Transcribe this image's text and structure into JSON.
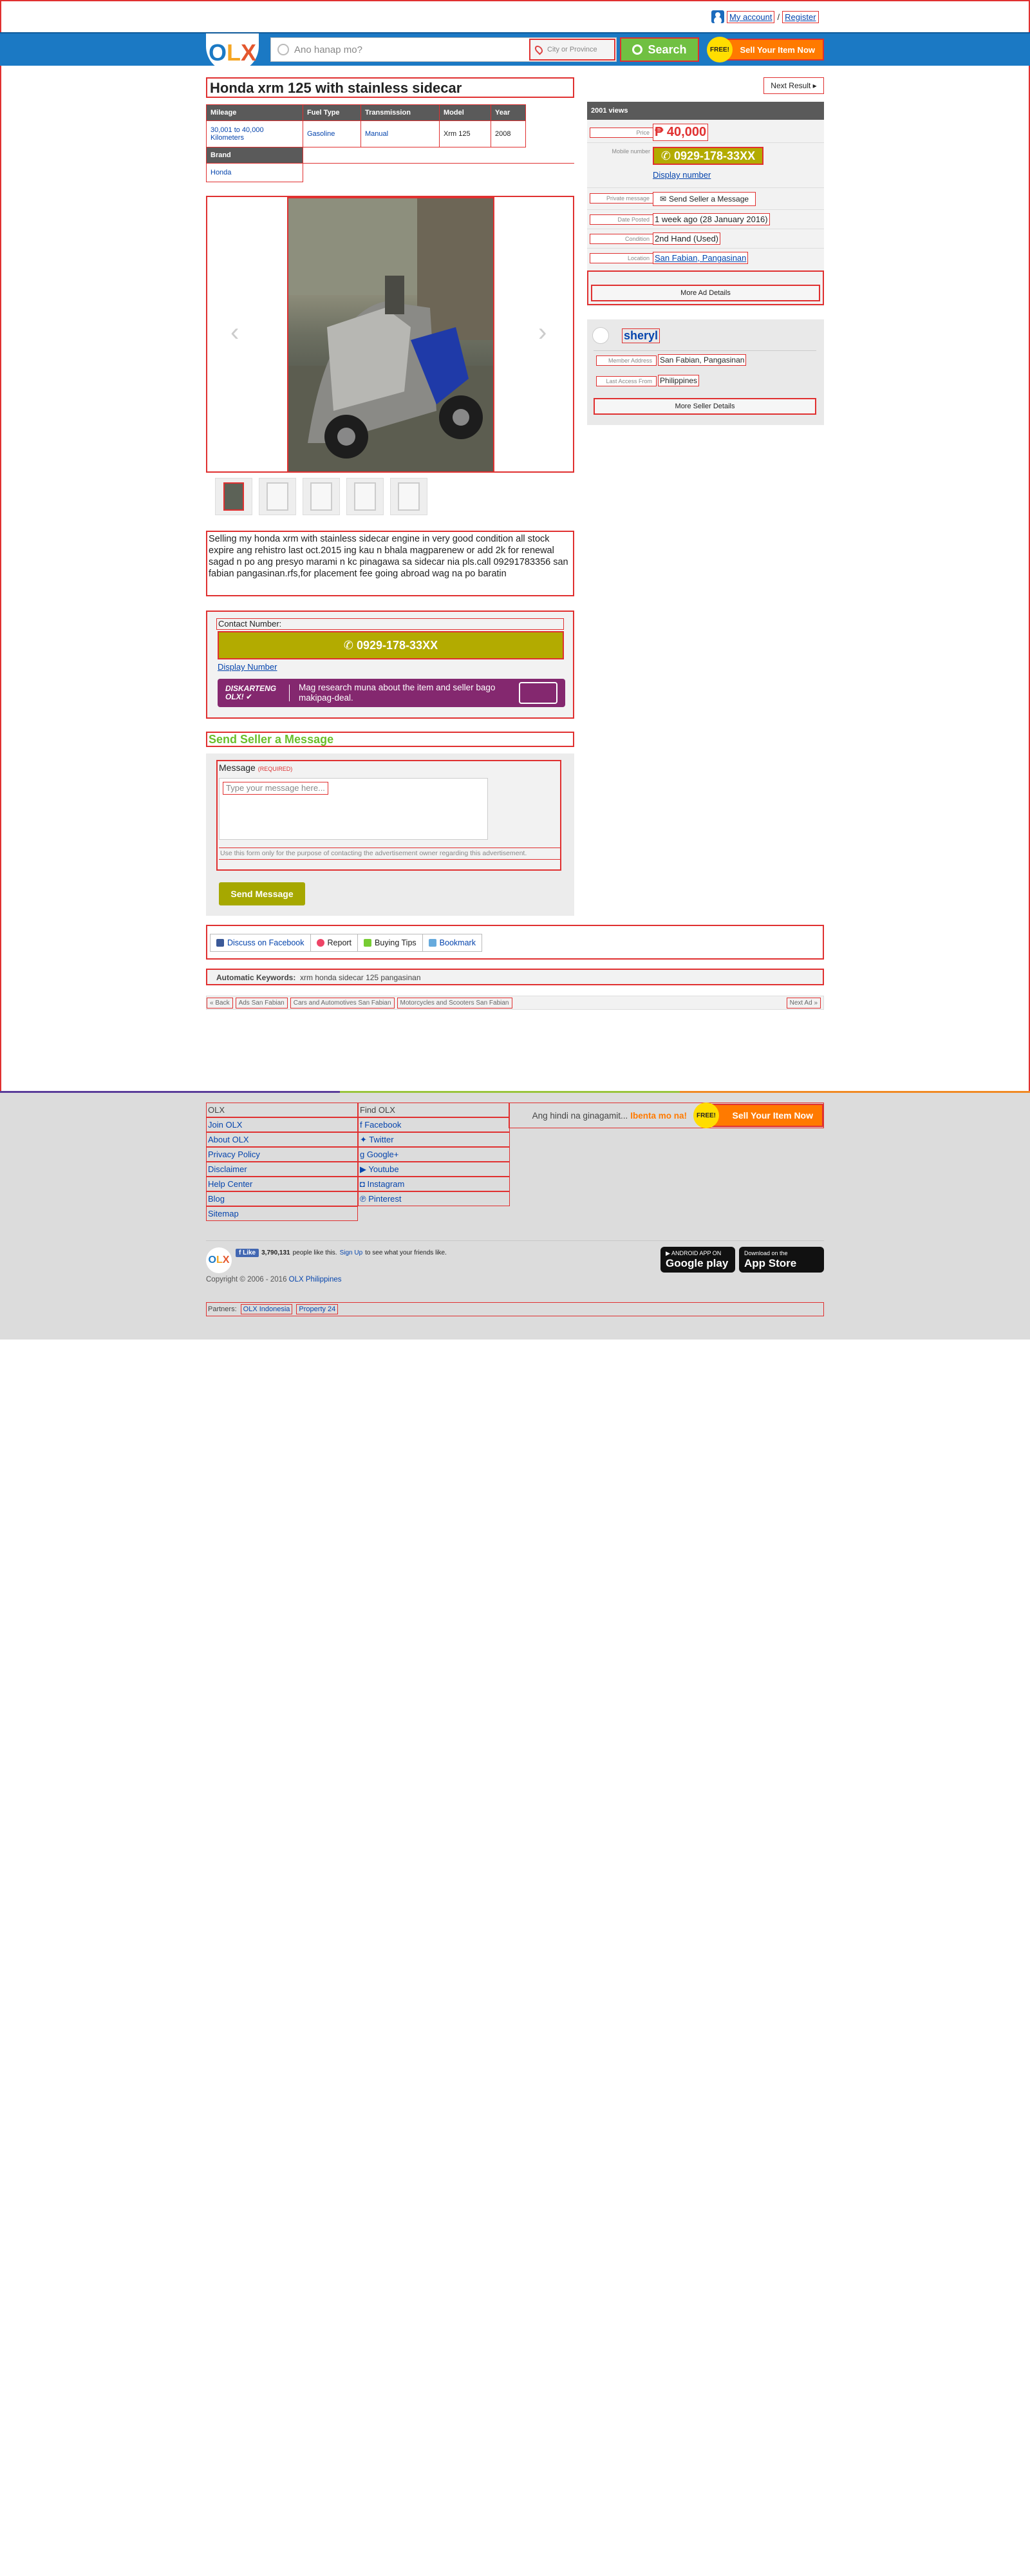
{
  "colors": {
    "brand_blue": "#1b79c4",
    "search_green": "#70c042",
    "sell_orange": "#ff7a00",
    "number_olive": "#b3ab00",
    "promo_purple": "#84286f",
    "price_red": "#e03030"
  },
  "top_bar": {
    "my_account": "My account",
    "separator": "/",
    "register": "Register"
  },
  "header": {
    "logo_o": "O",
    "logo_l": "L",
    "logo_x": "X",
    "search_placeholder": "Ano hanap mo?",
    "city_placeholder": "City or Province",
    "search_button": "Search",
    "free_badge": "FREE!",
    "sell_button": "Sell Your Item Now"
  },
  "ad": {
    "title": "Honda xrm 125 with stainless sidecar",
    "next_result": "Next Result",
    "specs_headers": [
      "Mileage",
      "Fuel Type",
      "Transmission",
      "Model",
      "Year"
    ],
    "specs_values": [
      "30,001 to 40,000 Kilometers",
      "Gasoline",
      "Manual",
      "Xrm 125",
      "2008"
    ],
    "brand_header": "Brand",
    "brand_value": "Honda",
    "description": "Selling my honda xrm with stainless sidecar engine in very good condition all stock expire ang rehistro last oct.2015 ing kau n bhala magparenew or add 2k for renewal sagad n po ang presyo marami n kc pinagawa sa sidecar nia pls.call 09291783356 san fabian pangasinan.rfs,for placement fee going abroad wag na po baratin"
  },
  "contact": {
    "label": "Contact Number:",
    "number": "0929-178-33XX",
    "display_number": "Display Number",
    "promo_brand_line1": "DISKARTENG",
    "promo_brand_line2": "OLX!",
    "promo_text": "Mag research muna about the item and seller bago makipag-deal."
  },
  "message": {
    "section_title": "Send Seller a Message",
    "label": "Message",
    "required": "(REQUIRED)",
    "placeholder": "Type your message here...",
    "note": "Use this form only for the purpose of contacting the advertisement owner regarding this advertisement.",
    "send_button": "Send Message"
  },
  "actions": {
    "facebook": "Discuss on Facebook",
    "report": "Report",
    "tips": "Buying Tips",
    "bookmark": "Bookmark"
  },
  "keywords": {
    "label": "Automatic Keywords:",
    "value": "xrm honda sidecar 125 pangasinan"
  },
  "breadcrumbs": {
    "back": "« Back",
    "items": [
      "Ads San Fabian",
      "Cars and Automotives San Fabian",
      "Motorcycles and Scooters San Fabian"
    ],
    "next": "Next Ad »"
  },
  "sidebar": {
    "views": "2001 views",
    "price_label": "Price",
    "price": "₱ 40,000",
    "mobile_label": "Mobile number",
    "mobile_number": "0929-178-33XX",
    "display_number": "Display number",
    "private_label": "Private message",
    "private_button": "Send Seller a Message",
    "date_label": "Date Posted",
    "date_value": "1 week ago (28 January 2016)",
    "condition_label": "Condition",
    "condition_value": "2nd Hand (Used)",
    "location_label": "Location",
    "location_value": "San Fabian, Pangasinan",
    "more_ad": "More Ad Details"
  },
  "seller": {
    "name": "sheryl",
    "address_label": "Member Address",
    "address_value": "San Fabian, Pangasinan",
    "access_label": "Last Access From",
    "access_value": "Philippines",
    "more_seller": "More Seller Details"
  },
  "footer": {
    "col1": [
      "OLX",
      "Join OLX",
      "About OLX",
      "Privacy Policy",
      "Disclaimer",
      "Help Center",
      "Blog",
      "Sitemap"
    ],
    "col2_title": "Find OLX",
    "col2": [
      "Facebook",
      "Twitter",
      "Google+",
      "Youtube",
      "Instagram",
      "Pinterest"
    ],
    "slogan": "Ang hindi na ginagamit...",
    "slogan_bold": "Ibenta mo na!",
    "free_badge": "FREE!",
    "sell_button": "Sell Your Item Now",
    "like_button": "Like",
    "like_count": "3,790,131",
    "like_text1": "people like this.",
    "like_signup": "Sign Up",
    "like_text2": "to see what your friends like.",
    "copyright": "Copyright © 2006 - 2016",
    "copyright_link": "OLX Philippines",
    "google_play_small": "ANDROID APP ON",
    "google_play": "Google play",
    "app_store_small": "Download on the",
    "app_store": "App Store",
    "partners_label": "Partners:",
    "partners": [
      "OLX Indonesia",
      "Property 24"
    ]
  }
}
